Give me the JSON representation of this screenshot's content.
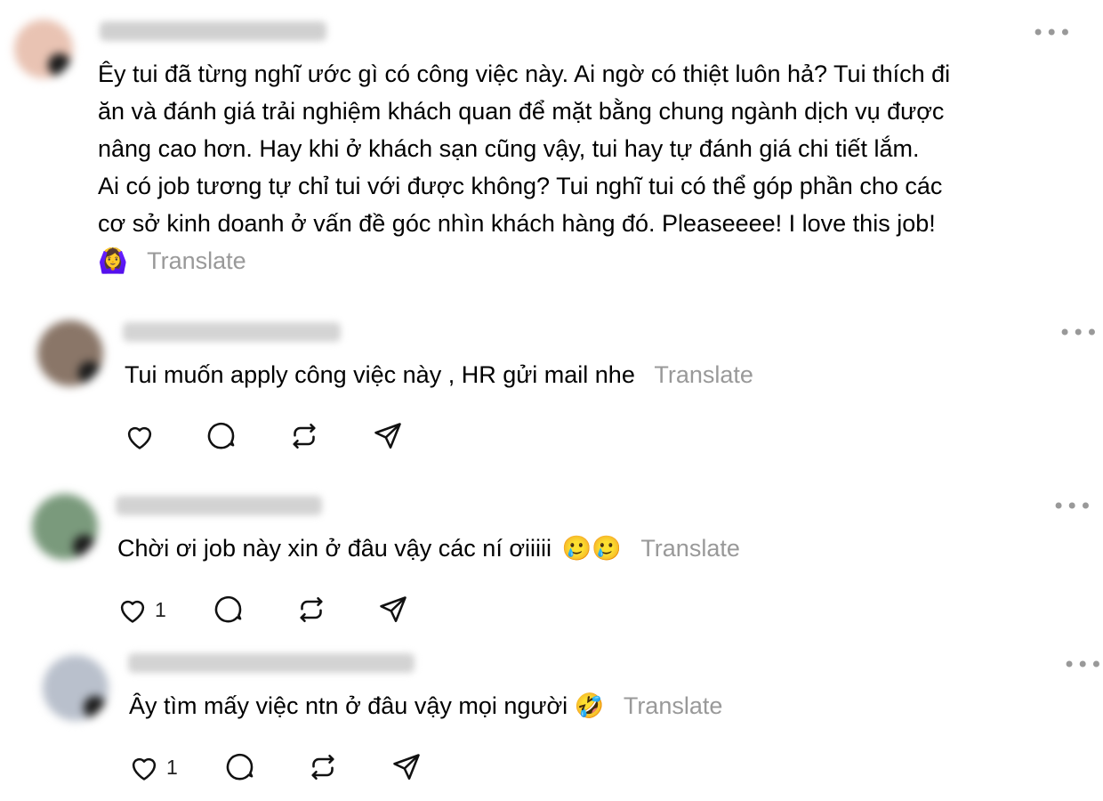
{
  "ui": {
    "more_label": "•••",
    "translate_label": "Translate"
  },
  "comments": [
    {
      "id": "c1",
      "lines": [
        "Êy tui đã từng nghĩ ước gì có công việc này. Ai ngờ có thiệt luôn hả? Tui thích đi",
        "ăn và đánh giá trải nghiệm khách quan để mặt bằng chung ngành dịch vụ được",
        "nâng cao hơn. Hay khi ở khách sạn cũng vậy, tui hay tự đánh giá chi tiết lắm.",
        "Ai có job tương tự chỉ tui với được không? Tui nghĩ tui có thể góp phần cho các",
        "cơ sở kinh doanh ở vấn đề góc nhìn khách hàng đó. Pleaseeee! I love this job!"
      ],
      "emoji": "🙆‍♀️",
      "avatar_color": "#e9c3b3"
    },
    {
      "id": "c2",
      "text": "Tui muốn apply công việc này , HR gửi mail nhe",
      "avatar_color": "#8a7668",
      "like_count": ""
    },
    {
      "id": "c3",
      "text": "Chời ơi job này xin ở đâu vậy các ní ơiiiii",
      "emoji": "🥲🥲",
      "avatar_color": "#7a9a7c",
      "like_count": "1"
    },
    {
      "id": "c4",
      "text": "Ây tìm mấy việc ntn ở đâu vậy mọi người",
      "emoji": "🤣",
      "avatar_color": "#b9c0cc",
      "like_count": "1"
    }
  ]
}
